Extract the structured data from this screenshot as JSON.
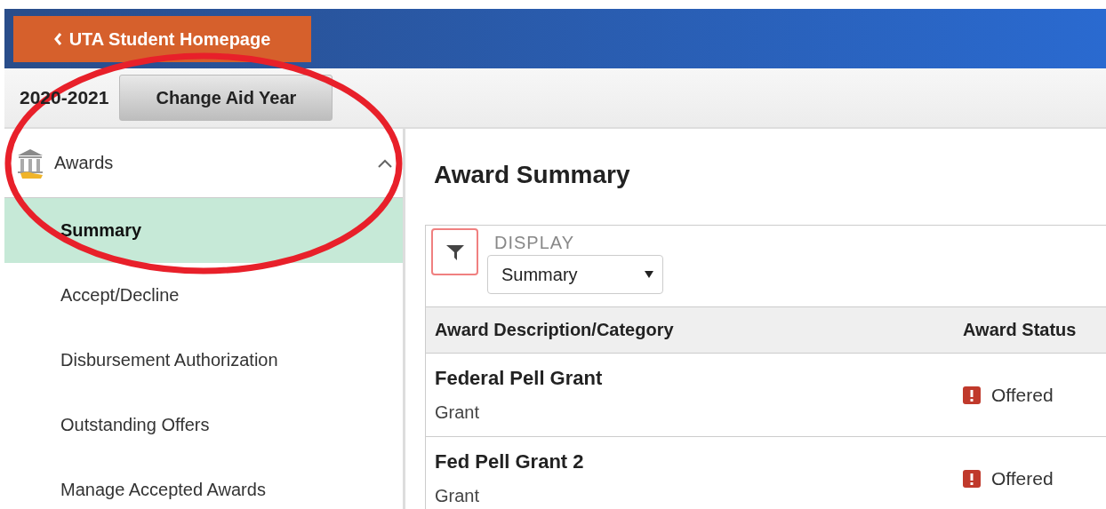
{
  "header": {
    "back_button": "UTA Student Homepage"
  },
  "aid_year": {
    "year": "2020-2021",
    "button": "Change Aid Year"
  },
  "sidebar": {
    "section": {
      "label": "Awards",
      "expanded": true,
      "items": [
        {
          "label": "Summary",
          "selected": true
        },
        {
          "label": "Accept/Decline",
          "selected": false
        },
        {
          "label": "Disbursement Authorization",
          "selected": false
        },
        {
          "label": "Outstanding Offers",
          "selected": false
        },
        {
          "label": "Manage Accepted Awards",
          "selected": false
        }
      ]
    }
  },
  "main": {
    "title": "Award Summary",
    "display": {
      "label": "DISPLAY",
      "value": "Summary"
    },
    "table": {
      "columns": [
        "Award Description/Category",
        "Award Status"
      ],
      "rows": [
        {
          "description": "Federal Pell Grant",
          "category": "Grant",
          "status": "Offered"
        },
        {
          "description": "Fed Pell Grant 2",
          "category": "Grant",
          "status": "Offered"
        }
      ]
    }
  },
  "annotation": {
    "kind": "ellipse"
  }
}
